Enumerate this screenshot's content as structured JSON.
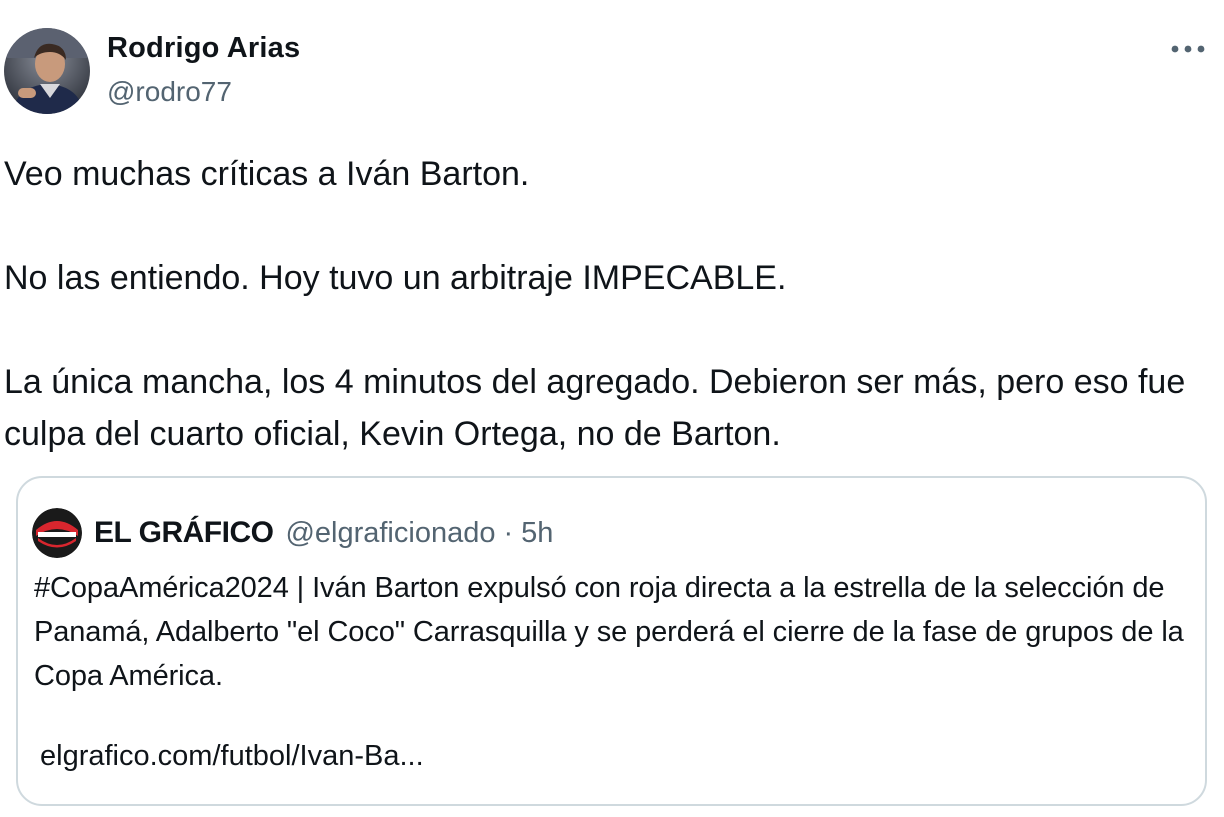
{
  "tweet": {
    "author": {
      "name": "Rodrigo Arias",
      "handle": "@rodro77",
      "avatar_icon": "profile-photo-avatar"
    },
    "more_icon": "more-options-icon",
    "paragraphs": [
      "Veo muchas críticas a Iván Barton.",
      "No las entiendo. Hoy tuvo un arbitraje IMPECABLE.",
      "La única mancha, los 4 minutos del agregado. Debieron ser más, pero eso fue culpa del cuarto oficial, Kevin Ortega, no de Barton."
    ]
  },
  "quote": {
    "author": {
      "name": "EL GRÁFICO",
      "handle": "@elgraficionado",
      "separator": "·",
      "time": "5h",
      "avatar_icon": "el-grafico-logo",
      "accent_color": "#d8262e"
    },
    "text": "#CopaAmérica2024 | Iván Barton expulsó con roja directa a la estrella de la selección de Panamá, Adalberto \"el Coco\" Carrasquilla y se perderá el cierre de la fase de grupos de la Copa América.",
    "link": "elgrafico.com/futbol/Ivan-Ba..."
  },
  "colors": {
    "text_primary": "#0f1419",
    "text_secondary": "#536471",
    "border": "#cfd9de",
    "background": "#ffffff"
  }
}
